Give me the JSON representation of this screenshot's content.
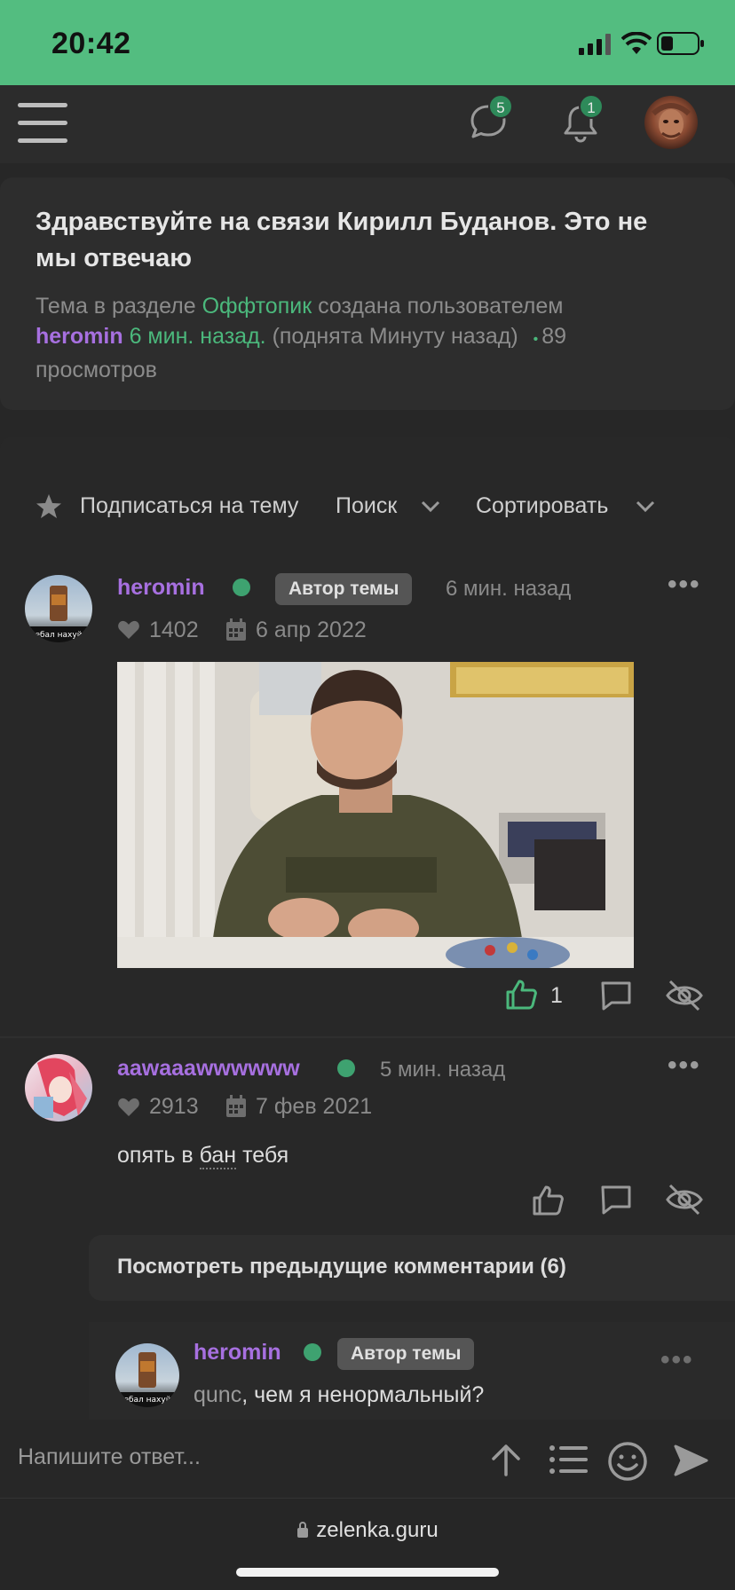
{
  "status_bar": {
    "time": "20:42"
  },
  "header": {
    "messages_count": "5",
    "alerts_count": "1"
  },
  "topic": {
    "title": "Здравствуйте на связи Кирилл Буданов. Это не мы отвечаю",
    "meta_prefix": "Тема в разделе",
    "section": "Оффтопик",
    "meta_created": "создана пользователем",
    "author": "heromin",
    "created_ago": "6 мин. назад.",
    "bumped": "(поднята Минуту назад)",
    "dot": "•",
    "views": "89",
    "views_label": "просмотров"
  },
  "toolbar": {
    "subscribe": "Подписаться на тему",
    "search": "Поиск",
    "sort": "Сортировать"
  },
  "posts": [
    {
      "username": "heromin",
      "author_badge": "Автор темы",
      "time": "6 мин. назад",
      "likes_total": "1402",
      "reg_date": "6 апр 2022",
      "post_likes": "1"
    },
    {
      "username": "aawaaawwwwww",
      "time": "5 мин. назад",
      "likes_total": "2913",
      "reg_date": "7 фев 2021",
      "text_before": "опять в",
      "text_link": "бан",
      "text_after": "тебя"
    }
  ],
  "comments": {
    "show_previous": "Посмотреть предыдущие комментарии (6)",
    "items": [
      {
        "username": "heromin",
        "author_badge": "Автор темы",
        "mention": "qunc",
        "text": ", чем я ненормальный?"
      }
    ]
  },
  "reply": {
    "placeholder": "Напишите ответ..."
  },
  "browser": {
    "url": "zelenka.guru"
  },
  "colors": {
    "accent": "#53bd80",
    "username": "#a770e0",
    "link": "#4bb87c"
  },
  "icons": [
    "menu-icon",
    "chat-icon",
    "bell-icon",
    "star-icon",
    "chevron-down-icon",
    "heart-icon",
    "calendar-icon",
    "like-icon",
    "comment-icon",
    "hide-icon",
    "arrow-up-icon",
    "list-icon",
    "smile-icon",
    "send-icon",
    "lock-icon"
  ]
}
